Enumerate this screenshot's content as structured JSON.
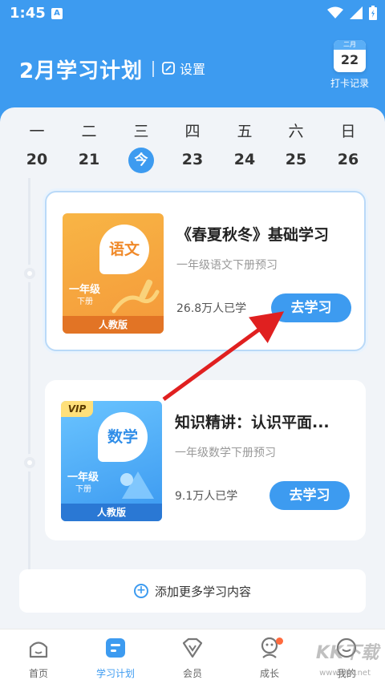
{
  "status": {
    "time": "1:45",
    "notif": "A"
  },
  "header": {
    "title": "2月学习计划",
    "settings": "设置",
    "checkin_month": "二月",
    "checkin_day": "22",
    "checkin_label": "打卡记录"
  },
  "week": [
    {
      "weekday": "一",
      "date": "20"
    },
    {
      "weekday": "二",
      "date": "21"
    },
    {
      "weekday": "三",
      "date": "今",
      "today": true
    },
    {
      "weekday": "四",
      "date": "23"
    },
    {
      "weekday": "五",
      "date": "24"
    },
    {
      "weekday": "六",
      "date": "25"
    },
    {
      "weekday": "日",
      "date": "26"
    }
  ],
  "courses": [
    {
      "title": "《春夏秋冬》基础学习",
      "subtitle": "一年级语文下册预习",
      "count": "26.8万人已学",
      "button": "去学习",
      "cover": {
        "subject": "语文",
        "grade": "一年级",
        "term": "下册",
        "publisher": "人教版"
      }
    },
    {
      "title": "知识精讲：认识平面...",
      "subtitle": "一年级数学下册预习",
      "count": "9.1万人已学",
      "button": "去学习",
      "cover": {
        "subject": "数学",
        "grade": "一年级",
        "term": "下册",
        "publisher": "人教版",
        "badge": "VIP"
      }
    }
  ],
  "add_more": "添加更多学习内容",
  "tabs": [
    {
      "label": "首页",
      "icon": "home-icon"
    },
    {
      "label": "学习计划",
      "icon": "study-plan-icon",
      "active": true
    },
    {
      "label": "会员",
      "icon": "vip-icon"
    },
    {
      "label": "成长",
      "icon": "growth-icon"
    },
    {
      "label": "我的",
      "icon": "profile-icon"
    }
  ],
  "watermark": {
    "logo": "KK下载",
    "url": "www.kkx.net"
  },
  "colors": {
    "primary": "#3d9bf0",
    "annotation_arrow": "#e02020"
  }
}
